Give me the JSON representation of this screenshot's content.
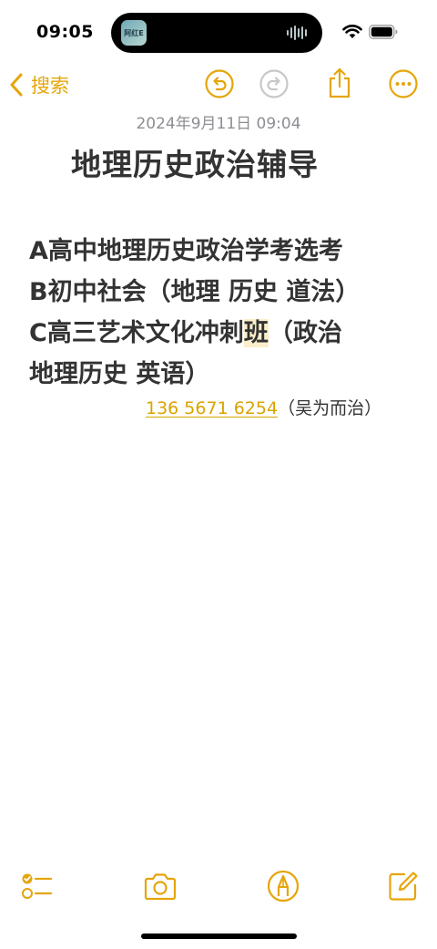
{
  "status_bar": {
    "time": "09:05",
    "island_app_label": "阿红E"
  },
  "toolbar": {
    "back_label": "搜索",
    "icons": [
      "chevron-left-icon",
      "undo-icon",
      "redo-icon",
      "share-icon",
      "more-icon"
    ]
  },
  "note": {
    "date": "2024年9月11日 09:04",
    "title": "地理历史政治辅导",
    "lines": [
      "A高中地理历史政治学考选考",
      "B初中社会（地理 历史 道法）",
      "C高三艺术文化冲刺",
      "班",
      "（政治",
      "地理历史 英语）"
    ],
    "phone": "136 5671 6254",
    "contact_suffix": "（吴为而治）"
  },
  "bottom_toolbar": {
    "icons": [
      "checklist-icon",
      "camera-icon",
      "markup-icon",
      "compose-icon"
    ]
  },
  "colors": {
    "accent": "#e5a50a",
    "link": "#d9a400",
    "highlight": "#fbeecb",
    "text": "#333333",
    "date": "#8e8e93"
  }
}
